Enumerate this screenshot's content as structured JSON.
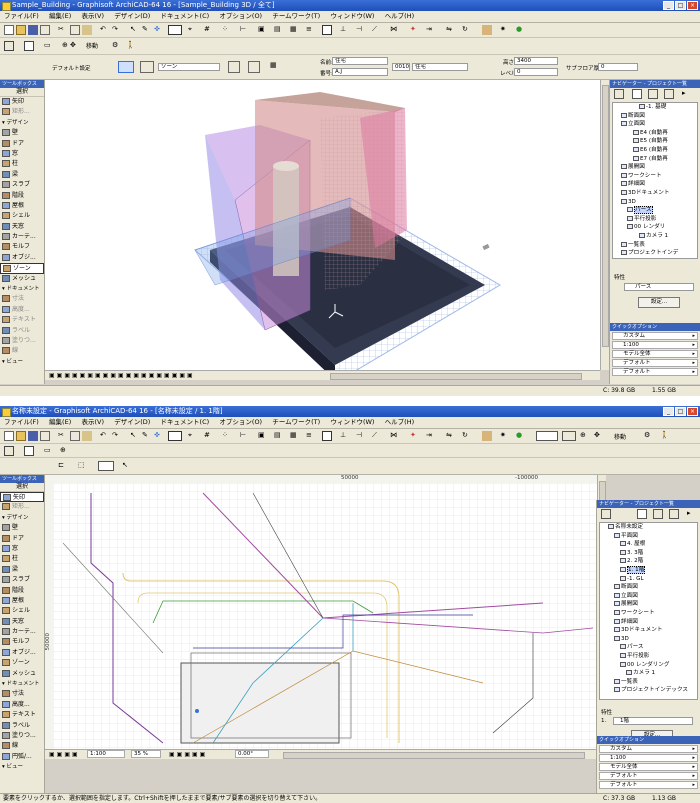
{
  "window1": {
    "title": "Sample_Building - Graphisoft ArchiCAD-64 16 - [Sample_Building 3D / 全て]",
    "menu": [
      "ファイル(F)",
      "編集(E)",
      "表示(V)",
      "デザイン(D)",
      "ドキュメント(C)",
      "オプション(O)",
      "チームワーク(T)",
      "ウィンドウ(W)",
      "ヘルプ(H)"
    ],
    "toolbar2_label": "移動",
    "info": {
      "default_label": "デフォルト設定",
      "zone_label": "ゾーン",
      "name_label": "名前:",
      "name_value": "住宅",
      "number_label": "番号:",
      "number_value": "A.J",
      "category_code": "0010",
      "category_name": "住宅",
      "height_label": "高さ:",
      "height_value": "3400",
      "level_label": "レベル:",
      "level_value": "0",
      "subfloor_label": "サブフロア厚さ:",
      "subfloor_value": "0"
    },
    "toolbox": {
      "title": "ツールボックス",
      "select": "選択",
      "items": [
        {
          "label": "矢印",
          "kind": "tool"
        },
        {
          "label": "矩形...",
          "kind": "tool",
          "dim": true
        },
        {
          "label": "デザイン",
          "kind": "header"
        },
        {
          "label": "壁",
          "kind": "tool"
        },
        {
          "label": "ドア",
          "kind": "tool"
        },
        {
          "label": "窓",
          "kind": "tool"
        },
        {
          "label": "柱",
          "kind": "tool"
        },
        {
          "label": "梁",
          "kind": "tool"
        },
        {
          "label": "スラブ",
          "kind": "tool"
        },
        {
          "label": "階段",
          "kind": "tool"
        },
        {
          "label": "屋根",
          "kind": "tool"
        },
        {
          "label": "シェル",
          "kind": "tool"
        },
        {
          "label": "天窓",
          "kind": "tool"
        },
        {
          "label": "カーテ...",
          "kind": "tool"
        },
        {
          "label": "モルフ",
          "kind": "tool"
        },
        {
          "label": "オブジ...",
          "kind": "tool"
        },
        {
          "label": "ゾーン",
          "kind": "tool",
          "active": true
        },
        {
          "label": "メッシュ",
          "kind": "tool"
        },
        {
          "label": "ドキュメント",
          "kind": "header"
        },
        {
          "label": "寸法",
          "kind": "tool",
          "dim": true
        },
        {
          "label": "高度...",
          "kind": "tool",
          "dim": true
        },
        {
          "label": "テキスト",
          "kind": "tool",
          "dim": true
        },
        {
          "label": "ラベル",
          "kind": "tool",
          "dim": true
        },
        {
          "label": "塗りつ...",
          "kind": "tool",
          "dim": true
        },
        {
          "label": "線",
          "kind": "tool",
          "dim": true
        },
        {
          "label": "ビュー",
          "kind": "header"
        }
      ]
    },
    "navigator": {
      "title": "ナビゲーター - プロジェクト一覧",
      "tree": [
        {
          "label": "-1. 基礎",
          "indent": 4
        },
        {
          "label": "断面図",
          "indent": 1
        },
        {
          "label": "立面図",
          "indent": 1
        },
        {
          "label": "E4 (自動再",
          "indent": 3
        },
        {
          "label": "E5 (自動再",
          "indent": 3
        },
        {
          "label": "E6 (自動再",
          "indent": 3
        },
        {
          "label": "E7 (自動再",
          "indent": 3
        },
        {
          "label": "展開図",
          "indent": 1
        },
        {
          "label": "ワークシート",
          "indent": 1
        },
        {
          "label": "詳細図",
          "indent": 1
        },
        {
          "label": "3Dドキュメント",
          "indent": 1
        },
        {
          "label": "3D",
          "indent": 1
        },
        {
          "label": "パース",
          "indent": 2,
          "selected": true
        },
        {
          "label": "平行投影",
          "indent": 2
        },
        {
          "label": "00 レンダリ",
          "indent": 2
        },
        {
          "label": "カメラ 1",
          "indent": 4
        },
        {
          "label": "一覧表",
          "indent": 1
        },
        {
          "label": "プロジェクトインデ",
          "indent": 1
        }
      ],
      "props_label": "特性",
      "props_value": "パース",
      "settings_button": "設定...",
      "quick_title": "クイックオプション",
      "quick_options": [
        "カスタム",
        "1:100",
        "モデル全体",
        "デフォルト",
        "デフォルト"
      ]
    },
    "status": {
      "disk": "C: 39.8 GB",
      "mem": "1.55 GB"
    }
  },
  "window2": {
    "title": "名称未設定 - Graphisoft ArchiCAD-64 16 - [名称未設定 / 1. 1階]",
    "menu": [
      "ファイル(F)",
      "編集(E)",
      "表示(V)",
      "デザイン(D)",
      "ドキュメント(C)",
      "オプション(O)",
      "チームワーク(T)",
      "ウィンドウ(W)",
      "ヘルプ(H)"
    ],
    "toolbar2_label": "移動",
    "ruler_marks": [
      "50000",
      "-100000"
    ],
    "side_ruler_mark": "50000",
    "toolbox": {
      "title": "ツールボックス",
      "select": "選択",
      "items": [
        {
          "label": "矢印",
          "kind": "tool",
          "active": true
        },
        {
          "label": "矩形...",
          "kind": "tool",
          "dim": true
        },
        {
          "label": "デザイン",
          "kind": "header"
        },
        {
          "label": "壁",
          "kind": "tool"
        },
        {
          "label": "ドア",
          "kind": "tool"
        },
        {
          "label": "窓",
          "kind": "tool"
        },
        {
          "label": "柱",
          "kind": "tool"
        },
        {
          "label": "梁",
          "kind": "tool"
        },
        {
          "label": "スラブ",
          "kind": "tool"
        },
        {
          "label": "階段",
          "kind": "tool"
        },
        {
          "label": "屋根",
          "kind": "tool"
        },
        {
          "label": "シェル",
          "kind": "tool"
        },
        {
          "label": "天窓",
          "kind": "tool"
        },
        {
          "label": "カーテ...",
          "kind": "tool"
        },
        {
          "label": "モルフ",
          "kind": "tool"
        },
        {
          "label": "オブジ...",
          "kind": "tool"
        },
        {
          "label": "ゾーン",
          "kind": "tool"
        },
        {
          "label": "メッシュ",
          "kind": "tool"
        },
        {
          "label": "ドキュメント",
          "kind": "header"
        },
        {
          "label": "寸法",
          "kind": "tool"
        },
        {
          "label": "高度...",
          "kind": "tool"
        },
        {
          "label": "テキスト",
          "kind": "tool"
        },
        {
          "label": "ラベル",
          "kind": "tool"
        },
        {
          "label": "塗りつ...",
          "kind": "tool"
        },
        {
          "label": "線",
          "kind": "tool"
        },
        {
          "label": "円弧/...",
          "kind": "tool"
        },
        {
          "label": "ビュー",
          "kind": "header"
        }
      ]
    },
    "navigator": {
      "title": "ナビゲーター - プロジェクト一覧",
      "tree": [
        {
          "label": "名称未設定",
          "indent": 1
        },
        {
          "label": "平面図",
          "indent": 2
        },
        {
          "label": "4. 屋根",
          "indent": 3
        },
        {
          "label": "3. 3階",
          "indent": 3
        },
        {
          "label": "2. 2階",
          "indent": 3
        },
        {
          "label": "1. 1階",
          "indent": 3,
          "selected": true
        },
        {
          "label": "-1. GL",
          "indent": 3
        },
        {
          "label": "断面図",
          "indent": 2
        },
        {
          "label": "立面図",
          "indent": 2
        },
        {
          "label": "展開図",
          "indent": 2
        },
        {
          "label": "ワークシート",
          "indent": 2
        },
        {
          "label": "詳細図",
          "indent": 2
        },
        {
          "label": "3Dドキュメント",
          "indent": 2
        },
        {
          "label": "3D",
          "indent": 2
        },
        {
          "label": "パース",
          "indent": 3
        },
        {
          "label": "平行投影",
          "indent": 3
        },
        {
          "label": "00 レンダリング",
          "indent": 3
        },
        {
          "label": "カメラ 1",
          "indent": 4
        },
        {
          "label": "一覧表",
          "indent": 2
        },
        {
          "label": "プロジェクトインデックス",
          "indent": 2
        }
      ],
      "props_label": "特性",
      "props_value": "1階",
      "props_number": "1.",
      "settings_button": "設定...",
      "quick_title": "クイックオプション",
      "quick_options": [
        "カスタム",
        "1:100",
        "モデル全体",
        "デフォルト",
        "デフォルト"
      ]
    },
    "bottom": {
      "scale": "1:100",
      "zoom": "35 %",
      "angle": "0.00°"
    },
    "status": {
      "message": "要素をクリックするか、選択範囲を指定します。Ctrl+Shiftを押したままで要素/サブ要素の選択を切り替えて下さい。",
      "disk": "C: 37.3 GB",
      "mem": "1.13 GB"
    }
  }
}
